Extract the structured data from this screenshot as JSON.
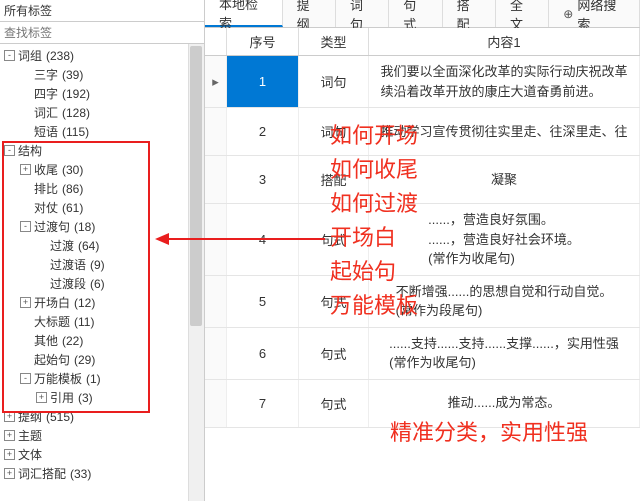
{
  "sidebar": {
    "title": "所有标签",
    "search_placeholder": "查找标签",
    "tree": [
      {
        "level": 0,
        "toggle": "-",
        "label": "词组",
        "count": "(238)"
      },
      {
        "level": 1,
        "toggle": "",
        "label": "三字",
        "count": "(39)"
      },
      {
        "level": 1,
        "toggle": "",
        "label": "四字",
        "count": "(192)"
      },
      {
        "level": 1,
        "toggle": "",
        "label": "词汇",
        "count": "(128)"
      },
      {
        "level": 1,
        "toggle": "",
        "label": "短语",
        "count": "(115)"
      },
      {
        "level": 0,
        "toggle": "-",
        "label": "结构",
        "count": ""
      },
      {
        "level": 1,
        "toggle": "+",
        "label": "收尾",
        "count": "(30)"
      },
      {
        "level": 1,
        "toggle": "",
        "label": "排比",
        "count": "(86)"
      },
      {
        "level": 1,
        "toggle": "",
        "label": "对仗",
        "count": "(61)"
      },
      {
        "level": 1,
        "toggle": "-",
        "label": "过渡句",
        "count": "(18)"
      },
      {
        "level": 2,
        "toggle": "",
        "label": "过渡",
        "count": "(64)"
      },
      {
        "level": 2,
        "toggle": "",
        "label": "过渡语",
        "count": "(9)"
      },
      {
        "level": 2,
        "toggle": "",
        "label": "过渡段",
        "count": "(6)"
      },
      {
        "level": 1,
        "toggle": "+",
        "label": "开场白",
        "count": "(12)"
      },
      {
        "level": 1,
        "toggle": "",
        "label": "大标题",
        "count": "(11)"
      },
      {
        "level": 1,
        "toggle": "",
        "label": "其他",
        "count": "(22)"
      },
      {
        "level": 1,
        "toggle": "",
        "label": "起始句",
        "count": "(29)"
      },
      {
        "level": 1,
        "toggle": "-",
        "label": "万能模板",
        "count": "(1)"
      },
      {
        "level": 2,
        "toggle": "+",
        "label": "引用",
        "count": "(3)"
      },
      {
        "level": 0,
        "toggle": "+",
        "label": "提纲",
        "count": "(515)"
      },
      {
        "level": 0,
        "toggle": "+",
        "label": "主题",
        "count": ""
      },
      {
        "level": 0,
        "toggle": "+",
        "label": "文体",
        "count": ""
      },
      {
        "level": 0,
        "toggle": "+",
        "label": "词汇搭配",
        "count": "(33)"
      }
    ]
  },
  "tabs": [
    "本地检索",
    "提纲",
    "词句",
    "句式",
    "搭配",
    "全文",
    "网络搜索"
  ],
  "active_tab": 0,
  "grid": {
    "headers": {
      "seq": "序号",
      "type": "类型",
      "content": "内容1"
    },
    "rows": [
      {
        "seq": "1",
        "type": "词句",
        "content": "我们要以全面深化改革的实际行动庆祝改革\n续沿着改革开放的康庄大道奋勇前进。",
        "active": true,
        "handle": "▸"
      },
      {
        "seq": "2",
        "type": "词句",
        "content": "推动学习宣传贯彻往实里走、往深里走、往"
      },
      {
        "seq": "3",
        "type": "搭配",
        "content": "凝聚"
      },
      {
        "seq": "4",
        "type": "句式",
        "content": "......，营造良好氛围。\n......，营造良好社会环境。\n(常作为收尾句)"
      },
      {
        "seq": "5",
        "type": "句式",
        "content": "不断增强......的思想自觉和行动自觉。\n(常作为段尾句)"
      },
      {
        "seq": "6",
        "type": "句式",
        "content": "......支持......支持......支撑......，实用性强\n(常作为收尾句)"
      },
      {
        "seq": "7",
        "type": "句式",
        "content": "推动......成为常态。"
      }
    ]
  },
  "overlay": {
    "lines": [
      "如何开场",
      "如何收尾",
      "如何过渡",
      "开场白",
      "起始句",
      "万能模板"
    ],
    "summary": "精准分类，实用性强"
  }
}
